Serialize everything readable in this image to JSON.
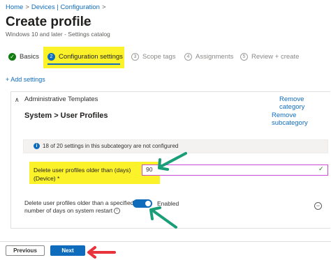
{
  "breadcrumb": [
    "Home",
    "Devices | Configuration"
  ],
  "page": {
    "title": "Create profile",
    "more_label": "...",
    "subtitle": "Windows 10 and later - Settings catalog"
  },
  "steps": [
    {
      "num": "✓",
      "label": "Basics",
      "state": "done"
    },
    {
      "num": "2",
      "label": "Configuration settings",
      "state": "active"
    },
    {
      "num": "3",
      "label": "Scope tags",
      "state": "todo"
    },
    {
      "num": "4",
      "label": "Assignments",
      "state": "todo"
    },
    {
      "num": "5",
      "label": "Review + create",
      "state": "todo"
    }
  ],
  "add_settings_label": "+ Add settings",
  "category": {
    "name": "Administrative Templates",
    "remove_label": "Remove category"
  },
  "subcategory": {
    "title": "System > User Profiles",
    "remove_label": "Remove subcategory",
    "info_text": "18 of 20 settings in this subcategory are not configured"
  },
  "settings": {
    "delete_older_label": "Delete user profiles older than (days) (Device) *",
    "delete_older_value": "90",
    "delete_restart_label": "Delete user profiles older than a specified number of days on system restart",
    "delete_restart_state": "Enabled",
    "delete_restart_enabled": true
  },
  "footer": {
    "previous_label": "Previous",
    "next_label": "Next"
  },
  "colors": {
    "accent": "#0f6cbd",
    "highlight": "#fbf22a",
    "arrow_green": "#1a9e78",
    "arrow_red": "#e8323c"
  }
}
